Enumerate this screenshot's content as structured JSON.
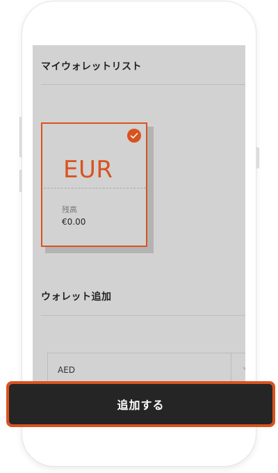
{
  "wallet_list": {
    "title": "マイウォレットリスト",
    "cards": [
      {
        "currency": "EUR",
        "selected": true,
        "balance_label": "残高",
        "balance": "€0.00"
      }
    ]
  },
  "add_wallet": {
    "title": "ウォレット追加",
    "currency_select": {
      "selected": "AED"
    }
  },
  "action_button": {
    "label": "追加する"
  },
  "colors": {
    "accent": "#d9531e",
    "screen_bg": "#d2d2d2",
    "button_bg": "#252525"
  },
  "icons": {
    "card_selected": "check-circle-icon",
    "select_arrow": "chevron-down-icon"
  }
}
